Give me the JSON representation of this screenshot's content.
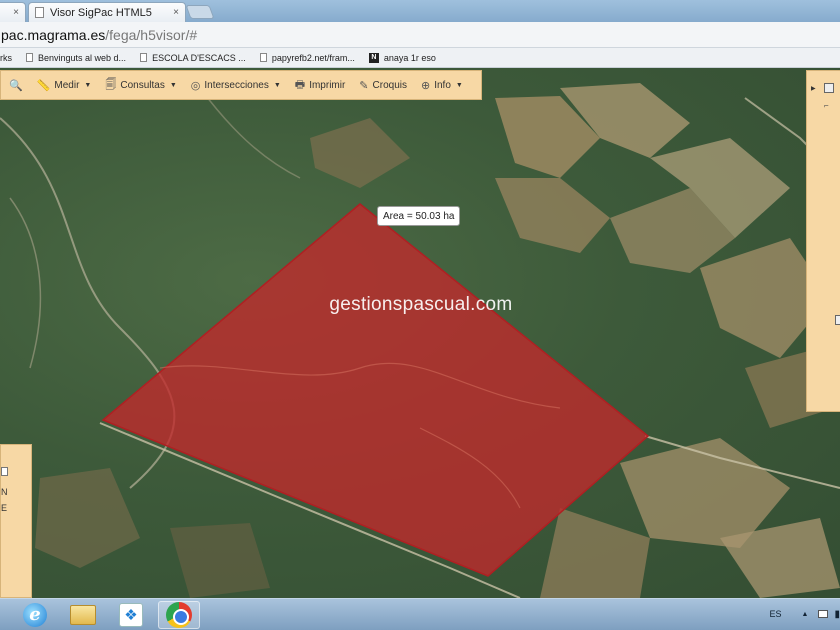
{
  "browser": {
    "tabs": [
      {
        "label": "",
        "close": "×"
      },
      {
        "label": "Visor SigPac HTML5",
        "close": "×"
      }
    ],
    "url": {
      "host": "pac.magrama.es",
      "path": "/fega/h5visor/#"
    },
    "bookmarks": [
      {
        "label": "rks",
        "icon": "none"
      },
      {
        "label": "Benvinguts al web d...",
        "icon": "page-icon"
      },
      {
        "label": "ESCOLA D'ESCACS ...",
        "icon": "page-icon"
      },
      {
        "label": "papyrefb2.net/fram...",
        "icon": "page-icon"
      },
      {
        "label": "anaya 1r eso",
        "icon": "n-logo-icon",
        "logo_text": "N"
      }
    ]
  },
  "map_toolbar": {
    "tools": [
      {
        "label": "Medir",
        "icon": "ruler-icon",
        "glyph": "📏",
        "dropdown": true
      },
      {
        "label": "Consultas",
        "icon": "query-icon",
        "glyph": "🗐",
        "dropdown": true
      },
      {
        "label": "Intersecciones",
        "icon": "intersect-icon",
        "glyph": "◎",
        "dropdown": true
      },
      {
        "label": "Imprimir",
        "icon": "print-icon",
        "glyph": "🖶",
        "dropdown": false
      },
      {
        "label": "Croquis",
        "icon": "sketch-icon",
        "glyph": "✎",
        "dropdown": false
      },
      {
        "label": "Info",
        "icon": "info-icon",
        "glyph": "⊕",
        "dropdown": true
      }
    ],
    "zoom_icon": "🔍"
  },
  "left_panel": {
    "lines": [
      "N",
      "E"
    ]
  },
  "area_label": "Area = 50.03 ha",
  "watermark": "gestionspascual.com",
  "colors": {
    "polygon_fill": "#c1292c",
    "toolbar": "#f7d8a5"
  },
  "taskbar": {
    "apps": [
      {
        "name": "internet-explorer",
        "glyph": "e"
      },
      {
        "name": "file-explorer"
      },
      {
        "name": "dropbox",
        "glyph": "❖"
      },
      {
        "name": "chrome",
        "active": true
      }
    ],
    "tray": {
      "lang": "ES",
      "up": "▲",
      "net": "▮"
    }
  }
}
